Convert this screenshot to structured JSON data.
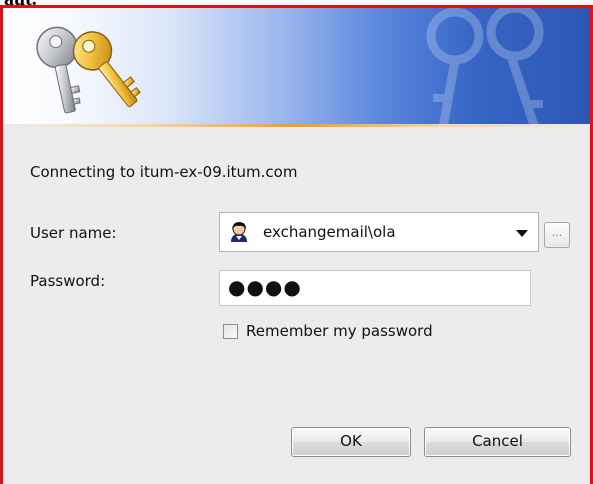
{
  "page": {
    "top_text": "aut."
  },
  "dialog": {
    "connecting_text": "Connecting to itum-ex-09.itum.com",
    "user_name_label": "User name:",
    "user_name_value": "exchangemail\\ola",
    "password_label": "Password:",
    "password_value": "●●●●",
    "browse_label": "...",
    "remember_label": "Remember my password",
    "remember_checked": false,
    "ok_label": "OK",
    "cancel_label": "Cancel"
  },
  "icons": {
    "banner_icon": "keys-icon",
    "user_icon": "user-avatar-icon",
    "dropdown_icon": "chevron-down-icon"
  },
  "colors": {
    "frame_border": "#d9151b",
    "banner_blue": "#2d57b5",
    "banner_orange": "#f39a2b",
    "dialog_background": "#ececec"
  }
}
